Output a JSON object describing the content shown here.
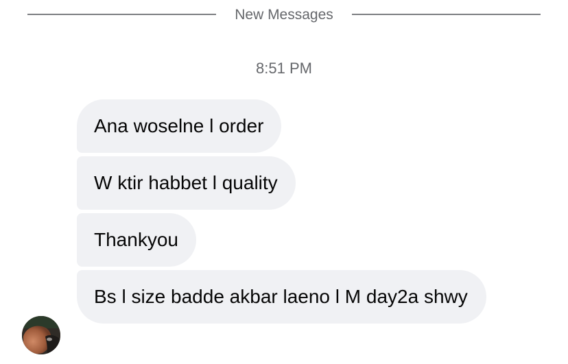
{
  "divider": {
    "label": "New Messages"
  },
  "timestamp": "8:51 PM",
  "messages": [
    {
      "text": "Ana woselne l order"
    },
    {
      "text": "W ktir habbet l quality"
    },
    {
      "text": "Thankyou"
    },
    {
      "text": "Bs l size badde akbar laeno l M day2a shwy"
    }
  ],
  "colors": {
    "bubble_background": "#f0f1f4",
    "meta_text": "#65676b",
    "message_text": "#050505"
  },
  "icons": {
    "avatar": "contact-avatar-photo"
  }
}
